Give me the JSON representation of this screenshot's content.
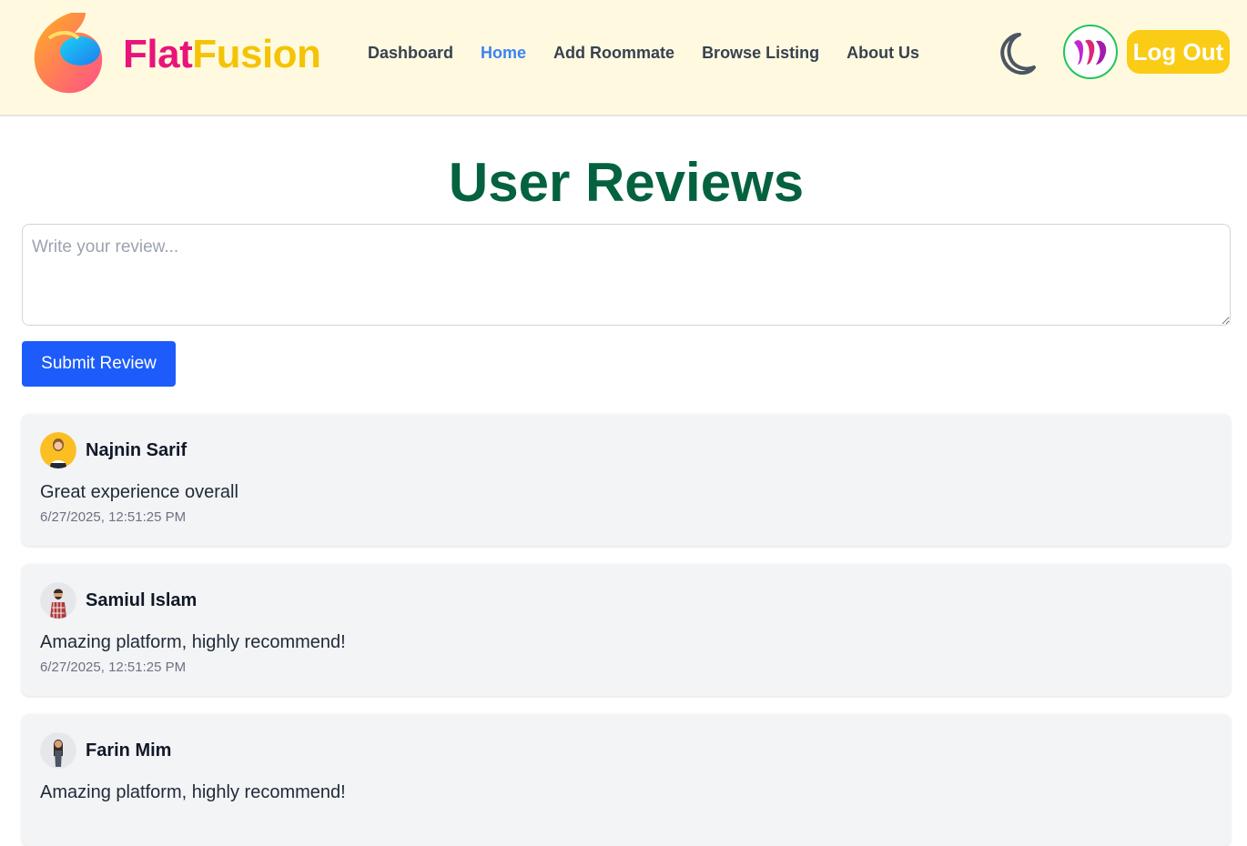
{
  "brand": {
    "part1": "Flat",
    "part2": "Fusion"
  },
  "nav": {
    "links": [
      {
        "label": "Dashboard",
        "active": false
      },
      {
        "label": "Home",
        "active": true
      },
      {
        "label": "Add Roommate",
        "active": false
      },
      {
        "label": "Browse Listing",
        "active": false
      },
      {
        "label": "About Us",
        "active": false
      }
    ],
    "theme_icon": "moon-icon",
    "logout_label": "Log Out"
  },
  "colors": {
    "accent_blue": "#3b82f6",
    "title_green": "#05623f",
    "logout_yellow": "#facc15",
    "submit_blue": "#1d5cfb"
  },
  "page": {
    "title": "User Reviews"
  },
  "review_form": {
    "placeholder": "Write your review...",
    "value": "",
    "submit_label": "Submit Review"
  },
  "reviews": [
    {
      "name": "Najnin Sarif",
      "text": "Great experience overall",
      "date": "6/27/2025, 12:51:25 PM"
    },
    {
      "name": "Samiul Islam",
      "text": "Amazing platform, highly recommend!",
      "date": "6/27/2025, 12:51:25 PM"
    },
    {
      "name": "Farin Mim",
      "text": "Amazing platform, highly recommend!",
      "date": ""
    }
  ]
}
